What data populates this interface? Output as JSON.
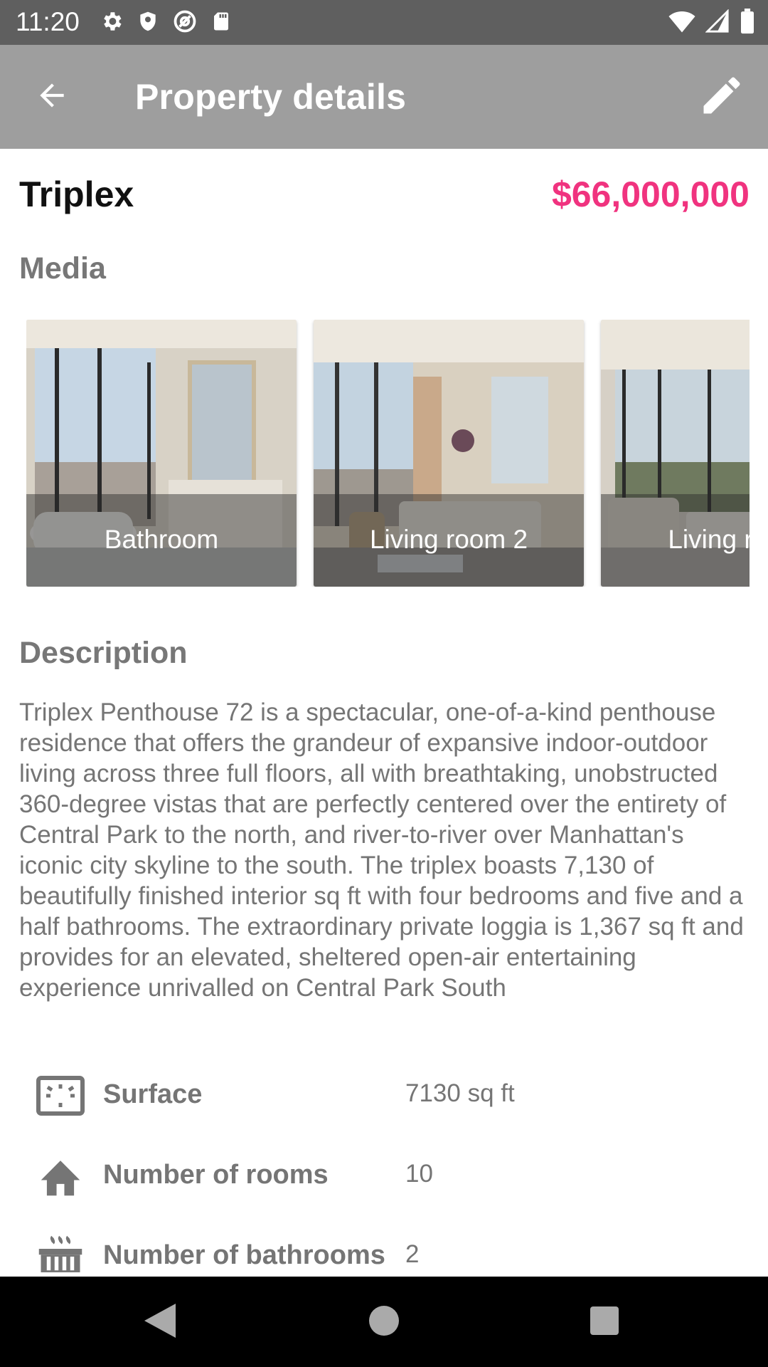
{
  "status_bar": {
    "time": "11:20",
    "left_icons": [
      "settings-icon",
      "shield-icon",
      "at-sign-icon",
      "sd-card-icon"
    ],
    "right_icons": [
      "wifi-icon",
      "signal-icon",
      "battery-icon"
    ]
  },
  "app_bar": {
    "title": "Property details",
    "back_icon": "arrow-back-icon",
    "edit_icon": "pencil-icon"
  },
  "property": {
    "type": "Triplex",
    "price": "$66,000,000",
    "price_color": "#f0337f"
  },
  "media": {
    "section_title": "Media",
    "items": [
      {
        "caption": "Bathroom"
      },
      {
        "caption": "Living room 2"
      },
      {
        "caption": "Living room"
      }
    ]
  },
  "description": {
    "section_title": "Description",
    "text": "Triplex Penthouse 72 is a spectacular, one-of-a-kind penthouse residence that offers the grandeur of expansive indoor-outdoor living across three full floors, all with breathtaking, unobstructed 360-degree vistas that are perfectly centered over the entirety of Central Park to the north, and river-to-river over Manhattan's iconic city skyline to the south.  The triplex boasts 7,130 of beautifully finished interior sq ft with four bedrooms and five and a half bathrooms.  The extraordinary private loggia is 1,367 sq ft and provides for an elevated, sheltered open-air entertaining experience unrivalled on Central Park South"
  },
  "details": [
    {
      "icon": "surface-icon",
      "label": "Surface",
      "value": "7130 sq ft"
    },
    {
      "icon": "home-icon",
      "label": "Number of rooms",
      "value": "10"
    },
    {
      "icon": "bathtub-icon",
      "label": "Number of bathrooms",
      "value": "2"
    }
  ],
  "nav_bar": {
    "buttons": [
      "back-triangle-icon",
      "home-circle-icon",
      "recents-square-icon"
    ]
  }
}
